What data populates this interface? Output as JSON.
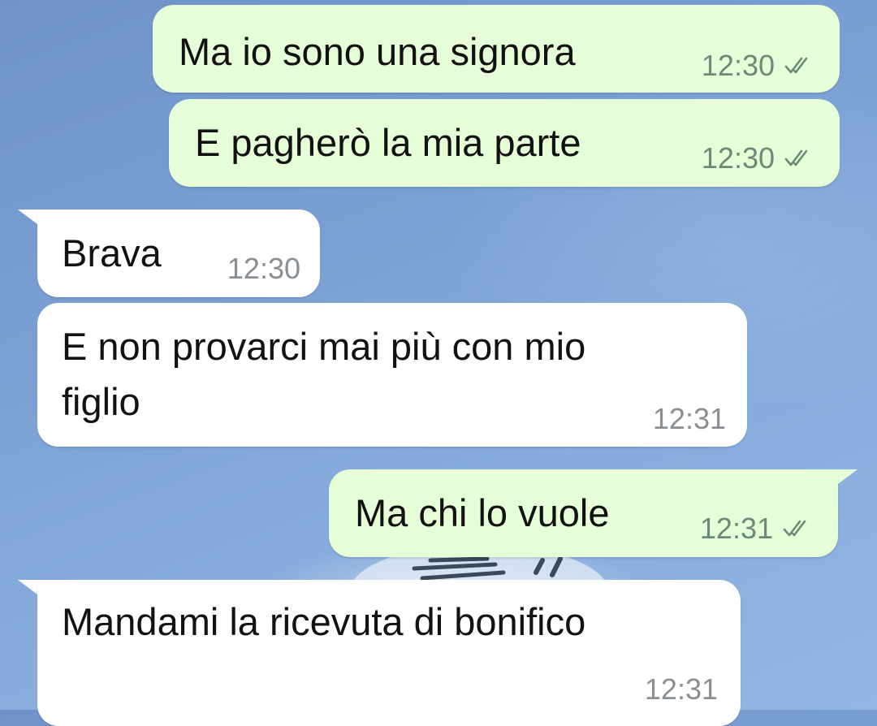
{
  "colors": {
    "outgoing_bubble": "#e6ffd8",
    "incoming_bubble": "#ffffff",
    "background": "#7aa0d3",
    "time_outgoing": "#6b8a78",
    "time_incoming": "#8a8f94",
    "read_ticks": "#6b8a78"
  },
  "messages": [
    {
      "direction": "outgoing",
      "text": "Ma io sono una signora",
      "time": "12:30",
      "status_icon": "double-check-icon"
    },
    {
      "direction": "outgoing",
      "text": "E pagherò la mia parte",
      "time": "12:30",
      "status_icon": "double-check-icon"
    },
    {
      "direction": "incoming",
      "text": "Brava",
      "time": "12:30"
    },
    {
      "direction": "incoming",
      "lines": [
        "E non provarci mai più con mio",
        "figlio"
      ],
      "time": "12:31"
    },
    {
      "direction": "outgoing",
      "text": "Ma chi lo vuole",
      "time": "12:31",
      "status_icon": "double-check-icon"
    },
    {
      "direction": "incoming",
      "text": "Mandami la ricevuta di bonifico",
      "time": "12:31"
    }
  ]
}
